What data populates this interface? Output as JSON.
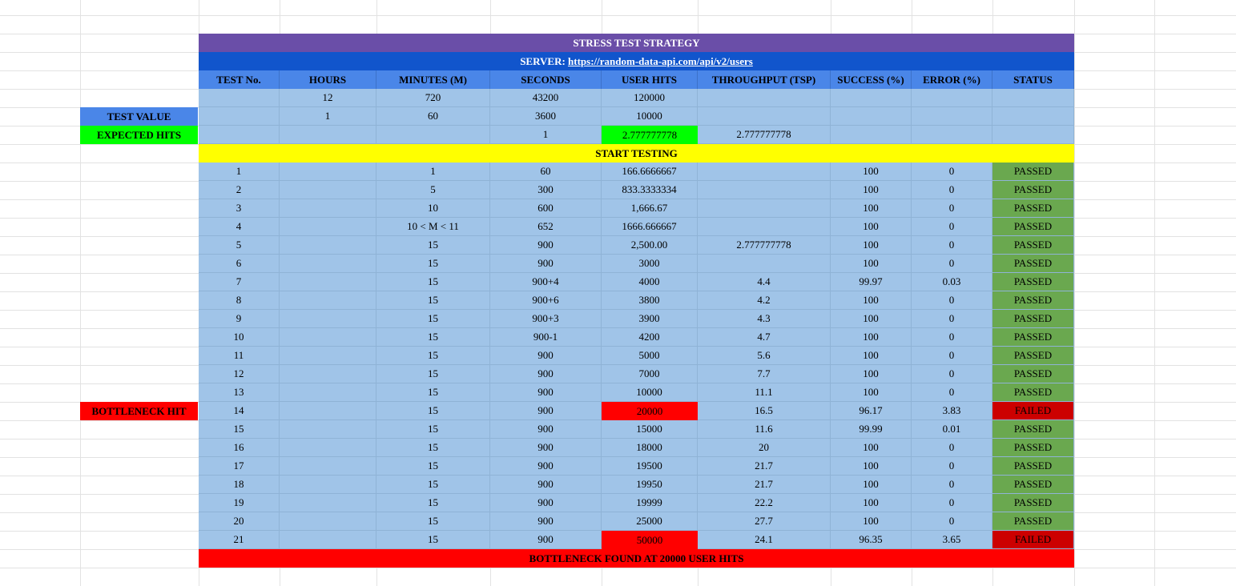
{
  "sheet": {
    "title": "STRESS TEST STRATEGY",
    "server_prefix": "SERVER: ",
    "server_url": "https://random-data-api.com/api/v2/users",
    "headers": [
      "TEST No.",
      "HOURS",
      "MINUTES (M)",
      "SECONDS",
      "USER HITS",
      "THROUGHPUT (TSP)",
      "SUCCESS (%)",
      "ERROR (%)",
      "STATUS"
    ],
    "summary_row": {
      "hours": "12",
      "minutes": "720",
      "seconds": "43200",
      "user_hits": "120000"
    },
    "test_value": {
      "label": "TEST VALUE",
      "hours": "1",
      "minutes": "60",
      "seconds": "3600",
      "user_hits": "10000"
    },
    "expected_hits": {
      "label": "EXPECTED HITS",
      "seconds": "1",
      "user_hits": "2.777777778",
      "throughput": "2.777777778"
    },
    "start_label": "START TESTING",
    "bottleneck_label": "BOTTLENECK HIT",
    "footer": "BOTTLENECK FOUND AT 20000 USER HITS",
    "colors": {
      "title_bg": "#6a4ea8",
      "server_bg": "#1155cc",
      "header_bg": "#4a86e8",
      "body_bg": "#a0c4e8",
      "passed_bg": "#6aa84f",
      "failed_bg": "#cc0000",
      "highlight_red": "#ff0000",
      "highlight_green": "#00ff00",
      "start_bg": "#ffff00"
    },
    "rows": [
      [
        "1",
        "",
        "1",
        "60",
        "166.6666667",
        "",
        "100",
        "0",
        "PASSED"
      ],
      [
        "2",
        "",
        "5",
        "300",
        "833.3333334",
        "",
        "100",
        "0",
        "PASSED"
      ],
      [
        "3",
        "",
        "10",
        "600",
        "1,666.67",
        "",
        "100",
        "0",
        "PASSED"
      ],
      [
        "4",
        "",
        "10 < M < 11",
        "652",
        "1666.666667",
        "",
        "100",
        "0",
        "PASSED"
      ],
      [
        "5",
        "",
        "15",
        "900",
        "2,500.00",
        "2.777777778",
        "100",
        "0",
        "PASSED"
      ],
      [
        "6",
        "",
        "15",
        "900",
        "3000",
        "",
        "100",
        "0",
        "PASSED"
      ],
      [
        "7",
        "",
        "15",
        "900+4",
        "4000",
        "4.4",
        "99.97",
        "0.03",
        "PASSED"
      ],
      [
        "8",
        "",
        "15",
        "900+6",
        "3800",
        "4.2",
        "100",
        "0",
        "PASSED"
      ],
      [
        "9",
        "",
        "15",
        "900+3",
        "3900",
        "4.3",
        "100",
        "0",
        "PASSED"
      ],
      [
        "10",
        "",
        "15",
        "900-1",
        "4200",
        "4.7",
        "100",
        "0",
        "PASSED"
      ],
      [
        "11",
        "",
        "15",
        "900",
        "5000",
        "5.6",
        "100",
        "0",
        "PASSED"
      ],
      [
        "12",
        "",
        "15",
        "900",
        "7000",
        "7.7",
        "100",
        "0",
        "PASSED"
      ],
      [
        "13",
        "",
        "15",
        "900",
        "10000",
        "11.1",
        "100",
        "0",
        "PASSED"
      ],
      [
        "14",
        "",
        "15",
        "900",
        "20000",
        "16.5",
        "96.17",
        "3.83",
        "FAILED"
      ],
      [
        "15",
        "",
        "15",
        "900",
        "15000",
        "11.6",
        "99.99",
        "0.01",
        "PASSED"
      ],
      [
        "16",
        "",
        "15",
        "900",
        "18000",
        "20",
        "100",
        "0",
        "PASSED"
      ],
      [
        "17",
        "",
        "15",
        "900",
        "19500",
        "21.7",
        "100",
        "0",
        "PASSED"
      ],
      [
        "18",
        "",
        "15",
        "900",
        "19950",
        "21.7",
        "100",
        "0",
        "PASSED"
      ],
      [
        "19",
        "",
        "15",
        "900",
        "19999",
        "22.2",
        "100",
        "0",
        "PASSED"
      ],
      [
        "20",
        "",
        "15",
        "900",
        "25000",
        "27.7",
        "100",
        "0",
        "PASSED"
      ],
      [
        "21",
        "",
        "15",
        "900",
        "50000",
        "24.1",
        "96.35",
        "3.65",
        "FAILED"
      ]
    ]
  }
}
